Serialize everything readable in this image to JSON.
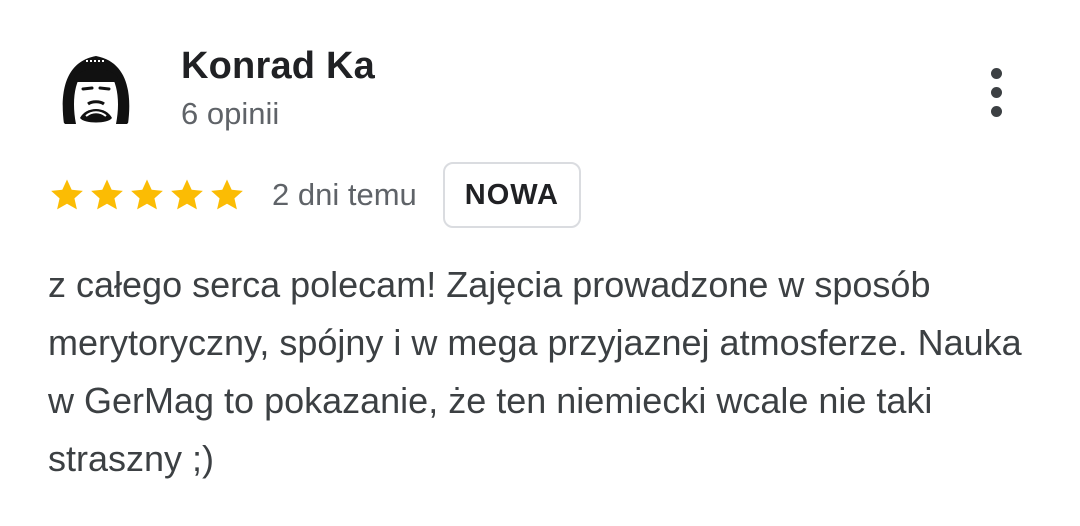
{
  "review": {
    "author": {
      "name": "Konrad Ka",
      "reviews_count": "6 opinii",
      "avatar_icon": "avatar-illustration-icon"
    },
    "menu_icon": "more-vert-icon",
    "rating": {
      "stars": 5,
      "max_stars": 5,
      "star_color": "#fbbc04",
      "star_icon": "star-icon"
    },
    "date": "2 dni temu",
    "badge": "NOWA",
    "text": "z całego serca polecam! Zajęcia prowadzone w sposób merytoryczny, spójny i w mega przyjaznej atmosferze. Nauka w GerMag to pokazanie, że ten niemiecki wcale nie taki straszny ;)"
  }
}
